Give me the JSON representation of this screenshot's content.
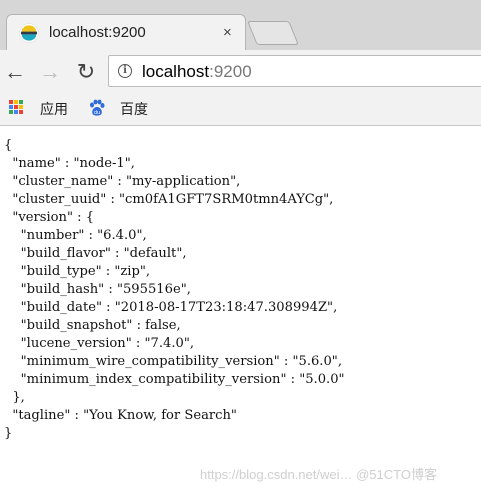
{
  "tab": {
    "title": "localhost:9200",
    "close_label": "×"
  },
  "nav": {
    "back": "←",
    "forward": "→",
    "reload": "↻"
  },
  "address": {
    "host": "localhost",
    "port": ":9200",
    "info_glyph": "i"
  },
  "bookmarks": {
    "apps_label": "应用",
    "baidu_label": "百度"
  },
  "json_lines": [
    "{",
    "  \"name\" : \"node-1\",",
    "  \"cluster_name\" : \"my-application\",",
    "  \"cluster_uuid\" : \"cm0fA1GFT7SRM0tmn4AYCg\",",
    "  \"version\" : {",
    "    \"number\" : \"6.4.0\",",
    "    \"build_flavor\" : \"default\",",
    "    \"build_type\" : \"zip\",",
    "    \"build_hash\" : \"595516e\",",
    "    \"build_date\" : \"2018-08-17T23:18:47.308994Z\",",
    "    \"build_snapshot\" : false,",
    "    \"lucene_version\" : \"7.4.0\",",
    "    \"minimum_wire_compatibility_version\" : \"5.6.0\",",
    "    \"minimum_index_compatibility_version\" : \"5.0.0\"",
    "  },",
    "  \"tagline\" : \"You Know, for Search\"",
    "}"
  ],
  "watermark": "https://blog.csdn.net/wei…  @51CTO博客"
}
